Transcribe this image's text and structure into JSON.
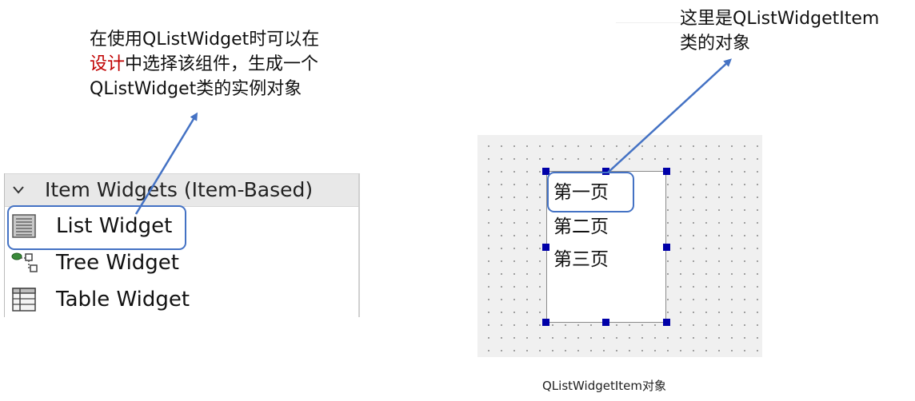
{
  "annotation_left": {
    "line1": "在使用QListWidget时可以在",
    "line2_red": "设计",
    "line2_rest": "中选择该组件，生成一个",
    "line3": "QListWidget类的实例对象"
  },
  "annotation_right": {
    "line1": "这里是QListWidgetItem",
    "line2": "类的对象"
  },
  "widget_box": {
    "category": {
      "label": "Item Widgets (Item-Based)",
      "icon": "chevron-down-icon"
    },
    "items": [
      {
        "label": "List Widget",
        "icon": "list-widget-icon"
      },
      {
        "label": "Tree Widget",
        "icon": "tree-widget-icon"
      },
      {
        "label": "Table Widget",
        "icon": "table-widget-icon"
      }
    ]
  },
  "list_widget": {
    "items": [
      "第一页",
      "第二页",
      "第三页"
    ]
  },
  "caption": "QListWidgetItem对象",
  "colors": {
    "accent": "#4472c4",
    "highlight_text": "#c00000",
    "handle": "#0000a8"
  }
}
